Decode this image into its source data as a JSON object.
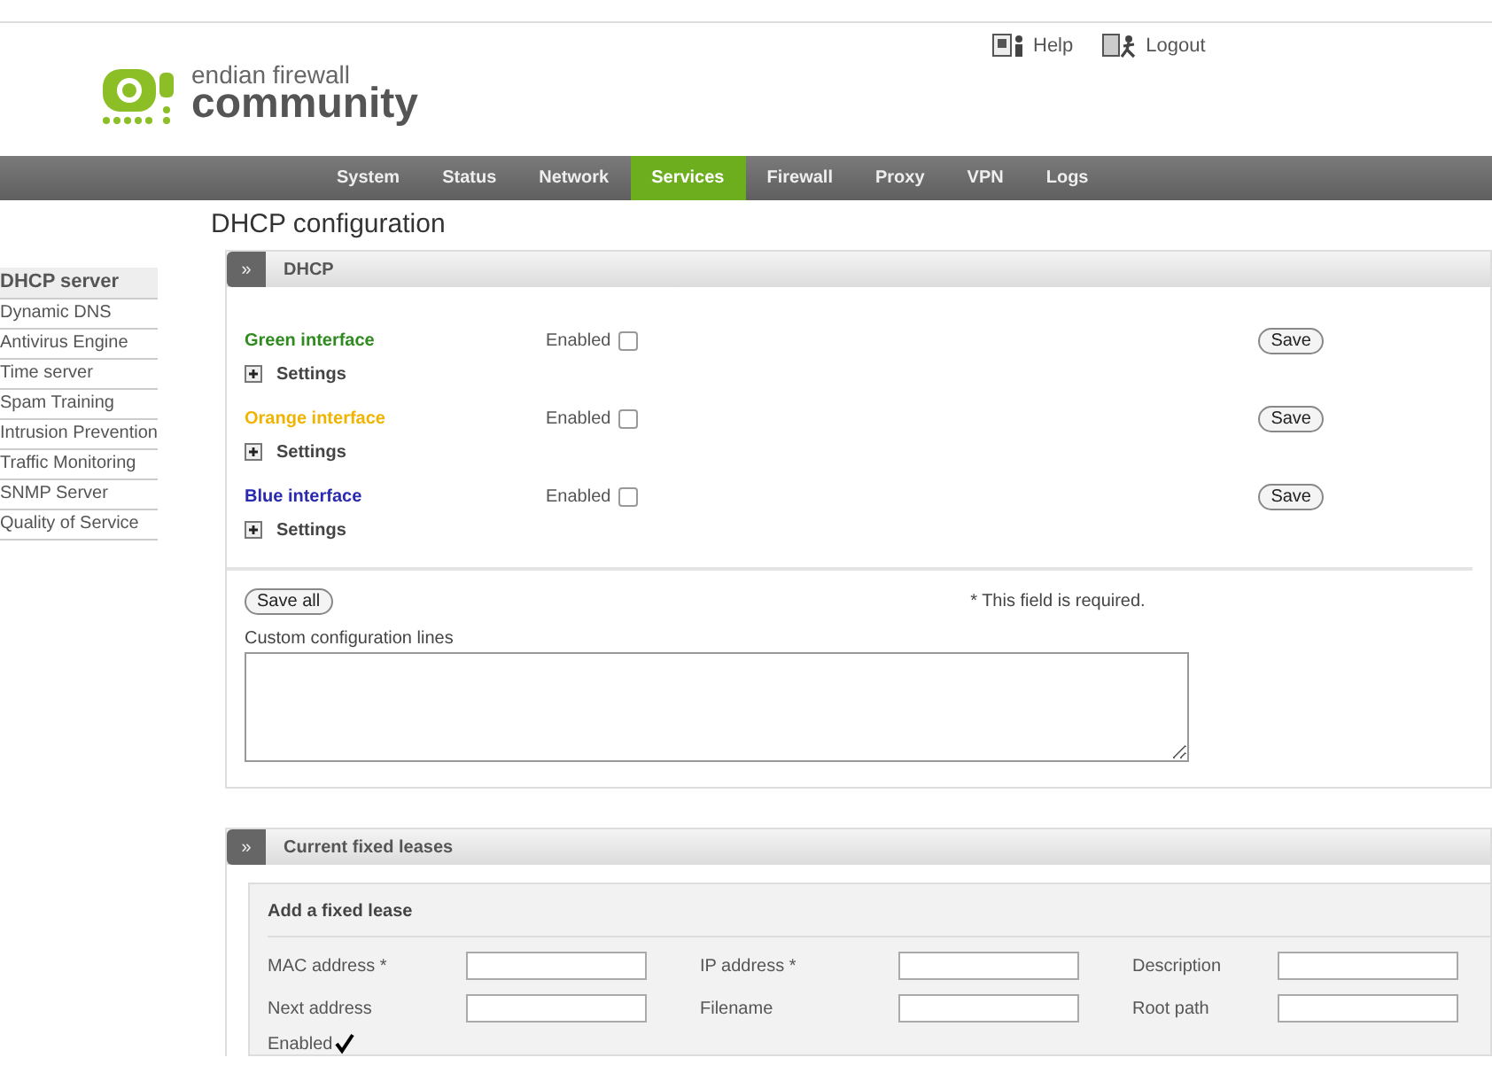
{
  "header": {
    "logo_line1": "endian firewall",
    "logo_line2": "community",
    "links": [
      {
        "kind": "help",
        "label": "Help"
      },
      {
        "kind": "logout",
        "label": "Logout"
      }
    ]
  },
  "nav": [
    {
      "label": "System",
      "selected": false
    },
    {
      "label": "Status",
      "selected": false
    },
    {
      "label": "Network",
      "selected": false
    },
    {
      "label": "Services",
      "selected": true
    },
    {
      "label": "Firewall",
      "selected": false
    },
    {
      "label": "Proxy",
      "selected": false
    },
    {
      "label": "VPN",
      "selected": false
    },
    {
      "label": "Logs",
      "selected": false
    }
  ],
  "sidebar": [
    {
      "label": "DHCP server",
      "selected": true
    },
    {
      "label": "Dynamic DNS",
      "selected": false
    },
    {
      "label": "Antivirus Engine",
      "selected": false
    },
    {
      "label": "Time server",
      "selected": false
    },
    {
      "label": "Spam Training",
      "selected": false
    },
    {
      "label": "Intrusion Prevention",
      "selected": false
    },
    {
      "label": "Traffic Monitoring",
      "selected": false
    },
    {
      "label": "SNMP Server",
      "selected": false
    },
    {
      "label": "Quality of Service",
      "selected": false
    }
  ],
  "page_title": "DHCP configuration",
  "dhcp": {
    "toggle": "»",
    "title": "DHCP",
    "interfaces": [
      {
        "name": "Green interface",
        "color": "#2f8a1f",
        "enabled_label": "Enabled",
        "enabled": false,
        "save": "Save",
        "settings": "Settings"
      },
      {
        "name": "Orange interface",
        "color": "#f0b400",
        "enabled_label": "Enabled",
        "enabled": false,
        "save": "Save",
        "settings": "Settings"
      },
      {
        "name": "Blue interface",
        "color": "#2a2ab0",
        "enabled_label": "Enabled",
        "enabled": false,
        "save": "Save",
        "settings": "Settings"
      }
    ],
    "save_all": "Save all",
    "required_note": "* This field is required.",
    "custom_label": "Custom configuration lines"
  },
  "leases": {
    "toggle": "»",
    "title": "Current fixed leases",
    "form_title": "Add a fixed lease",
    "fields": [
      {
        "label": "MAC address *"
      },
      {
        "label": "IP address *"
      },
      {
        "label": "Description"
      },
      {
        "label": "Next address"
      },
      {
        "label": "Filename"
      },
      {
        "label": "Root path"
      }
    ],
    "enabled_label": "Enabled",
    "enabled": true
  }
}
